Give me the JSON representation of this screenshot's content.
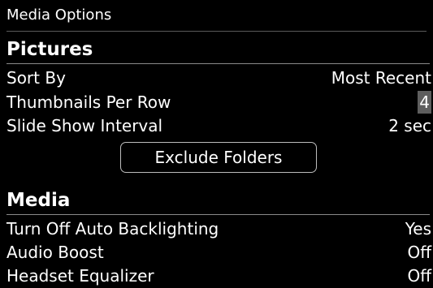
{
  "window": {
    "title": "Media Options"
  },
  "pictures": {
    "header": "Pictures",
    "rows": [
      {
        "label": "Sort By",
        "value": "Most Recent"
      },
      {
        "label": "Thumbnails Per Row",
        "value": "4"
      },
      {
        "label": "Slide Show Interval",
        "value": "2 sec"
      }
    ],
    "exclude_button": "Exclude Folders"
  },
  "media": {
    "header": "Media",
    "rows": [
      {
        "label": "Turn Off Auto Backlighting",
        "value": "Yes"
      },
      {
        "label": "Audio Boost",
        "value": "Off"
      },
      {
        "label": "Headset Equalizer",
        "value": "Off"
      }
    ]
  },
  "colors": {
    "background": "#000000",
    "text": "#ffffff",
    "selection": "#5e5e5e"
  }
}
